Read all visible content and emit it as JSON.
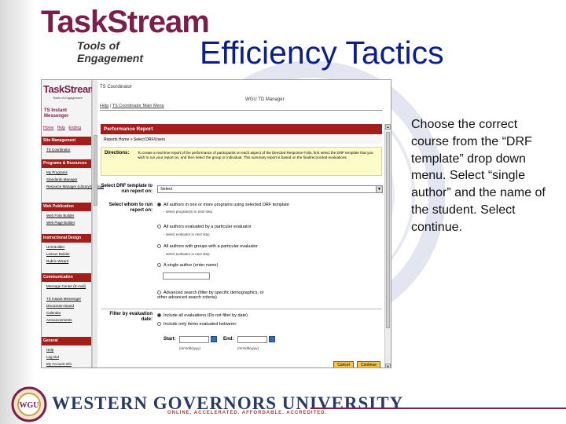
{
  "slide": {
    "logo_main": "TaskStream",
    "logo_sub": "Tools of Engagement",
    "title": "Efficiency Tactics",
    "body": "Choose the correct course from the “DRF template” drop down menu. Select “single author” and the name of the student. Select continue.",
    "footer_name": "WESTERN GOVERNORS UNIVERSITY",
    "footer_tag": "ONLINE. ACCELERATED. AFFORDABLE. ACCREDITED.",
    "seal_initials": "WGU",
    "colors": {
      "title": "#0b1f8a",
      "brand": "#7a1f4a",
      "section": "#a31d1d",
      "directions_bg": "#fdfcc8"
    }
  },
  "screenshot": {
    "logo_main": "TaskStream",
    "logo_sub": "Tools of Engagement",
    "instant_messenger": "TS Instant Messenger",
    "nav": [
      "Home",
      "Help",
      "Ending"
    ],
    "sidebar": [
      {
        "title": "Site Management",
        "links": [
          "TS Coordinator"
        ]
      },
      {
        "title": "Programs & Resources",
        "links": [
          "My Programs",
          "Standards Manager",
          "Resource Manager (Library/Catalog)"
        ]
      },
      {
        "title": "Web Publication",
        "links": [
          "Web Folio Builder",
          "Web Page Builder"
        ]
      },
      {
        "title": "Instructional Design",
        "links": [
          "Unit Builder",
          "Lesson Builder",
          "Rubric Wizard"
        ]
      },
      {
        "title": "Communication",
        "links": [
          "Message Center (E-mail)",
          "TS Instant Messenger",
          "Discussion Board",
          "Calendar",
          "Announcements"
        ]
      },
      {
        "title": "General",
        "links": [
          "Help",
          "Log Out",
          "My Account Info"
        ]
      }
    ],
    "header": {
      "coordinator": "TS Coordinator",
      "manager": "WGU TD Manager",
      "help_link": "Help",
      "main_menu_link": "TS Coordinator Main Menu"
    },
    "section_title": "Performance Report",
    "breadcrumb": "Reports Home > Select DRF/Users",
    "directions_label": "Directions:",
    "directions_text": "To create a real time report of the performance of participants on each aspect of the Directed Response Folio, first select the DRF template that you wish to run your report on, and then select the group or individual. This summary report is based on the final/reconciled evaluations.",
    "drf_label": "Select DRF template to run report on:",
    "drf_value": "Select",
    "whom_label": "Select whom to run report on:",
    "options": [
      {
        "label": "All authors in one or more programs using selected DRF template",
        "hint": "- select program(s) in next step",
        "selected": true
      },
      {
        "label": "All authors evaluated by a particular evaluator",
        "hint": "- select evaluator in next step",
        "selected": false
      },
      {
        "label": "All authors with groups with a particular evaluator",
        "hint": "- select evaluator in next step",
        "selected": false
      },
      {
        "label": "A single author (enter name)",
        "hint": "",
        "selected": false
      },
      {
        "label": "Advanced search (filter by specific demographics, or other advanced search criteria)",
        "hint": "",
        "selected": false
      }
    ],
    "filter_label": "Filter by evaluation date:",
    "filter_options": [
      {
        "label": "Include all evaluations (Do not filter by date)",
        "selected": true
      },
      {
        "label": "Include only items evaluated between:",
        "selected": false
      }
    ],
    "start_label": "Start:",
    "end_label": "End:",
    "date_format": "(mm/dd/yyyy)",
    "cancel_label": "Cancel",
    "continue_label": "Continue"
  }
}
